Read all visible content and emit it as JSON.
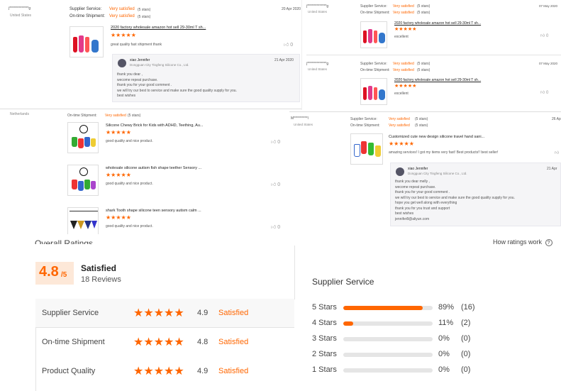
{
  "reviews": {
    "r1": {
      "name": "j**************g",
      "country": "United States",
      "service_label": "Supplier Service:",
      "service_value": "Very satisfied",
      "service_stars": "(5 stars)",
      "ship_label": "On-time Shipment:",
      "ship_value": "Very satisfied",
      "ship_stars": "(5 stars)",
      "date": "20 Apr 2020",
      "product": "2020 factory wholesale amazon hot sell 29-30ml T sh...",
      "rating": "★★★★★",
      "comment": "great quality fast shipment thank",
      "likes": "0",
      "reply": {
        "author": "xiao Jennifer",
        "company": "Dongguan City Tingfeng Silicone Co., Ltd.",
        "date": "21 Apr 2020",
        "lines": [
          "thank you dear ,",
          "wecome repeat purchase.",
          "thank you for your good comment .",
          "we will try our best to service and make sure the good quality supply for you.",
          "best wishes"
        ]
      }
    },
    "r2": {
      "name": "j**************g",
      "country": "United States",
      "service_label": "Supplier Service:",
      "service_value": "Very satisfied",
      "service_stars": "(5 stars)",
      "ship_label": "On-time Shipment:",
      "ship_value": "Very satisfied",
      "ship_stars": "(5 stars)",
      "date": "07 May 2020",
      "product": "2020 factory wholesale amazon hot sell 29-30ml T sh...",
      "rating": "★★★★★",
      "comment": "excellent",
      "likes": "0"
    },
    "r3": {
      "name": "j**************g",
      "country": "United States",
      "service_label": "Supplier Service:",
      "service_value": "Very satisfied",
      "service_stars": "(5 stars)",
      "ship_label": "On-time Shipment:",
      "ship_value": "Very satisfied",
      "ship_stars": "(5 stars)",
      "date": "07 May 2020",
      "product": "2020 factory wholesale amazon hot sell 29-30ml T sh...",
      "rating": "★★★★★",
      "comment": "excellent",
      "likes": "0"
    },
    "r4": {
      "country": "Netherlands",
      "ship_label": "On-time Shipment:",
      "ship_value": "Very satisfied",
      "ship_stars": "(5 stars)",
      "items": [
        {
          "product": "Silicone Chewy Brick for Kids with ADHD, Teething, Au...",
          "rating": "★★★★★",
          "comment": "good quality and nice product.",
          "likes": "0"
        },
        {
          "product": "wholesale silicone autism fish shape teether Sensory ...",
          "rating": "★★★★★",
          "comment": "good quality and nice product.",
          "likes": "0"
        },
        {
          "product": "shark Tooth shape silicone teen sensory autism calm ...",
          "rating": "★★★★★",
          "comment": "good quality and nice product.",
          "likes": "0"
        }
      ]
    },
    "r5": {
      "name": "M**********l",
      "country": "United States",
      "service_label": "Supplier Service:",
      "service_value": "Very satisfied",
      "service_stars": "(5 stars)",
      "ship_label": "On-time Shipment:",
      "ship_value": "Very satisfied",
      "ship_stars": "(5 stars)",
      "date": "26 Ap",
      "product": "Customized cute new design silicone travel hand sani...",
      "rating": "★★★★★",
      "comment": "amazing services! I got my items very fast! Best products!! best seller!",
      "likes": "0",
      "reply": {
        "author": "xiao Jennifer",
        "company": "Dongguan City Tingfeng Silicone Co., Ltd.",
        "date": "21 Apr",
        "lines": [
          "thank you dear melly ,",
          "wecome repeat purchase.",
          "thank you for your good comment .",
          "we will try our best to service and make sure the good quality supply for you.",
          "hope you get well along with everything",
          "thank you for you trust and support",
          "best wishes",
          "jennifer8@aliyun.com"
        ]
      }
    }
  },
  "overall": {
    "title": "Overall Ratings",
    "score": "4.8",
    "score_denom": "/5",
    "label": "Satisfied",
    "reviews": "18 Reviews",
    "how_link": "How ratings work",
    "help_icon": "?"
  },
  "categories": [
    {
      "label": "Supplier Service",
      "stars": "★★★★★",
      "score": "4.9",
      "word": "Satisfied"
    },
    {
      "label": "On-time Shipment",
      "stars": "★★★★★",
      "score": "4.8",
      "word": "Satisfied"
    },
    {
      "label": "Product Quality",
      "stars": "★★★★★",
      "score": "4.9",
      "word": "Satisfied"
    }
  ],
  "distribution": {
    "title": "Supplier Service",
    "rows": [
      {
        "label": "5 Stars",
        "fraction": 0.89,
        "pct": "89%",
        "count": "(16)"
      },
      {
        "label": "4 Stars",
        "fraction": 0.11,
        "pct": "11%",
        "count": "(2)"
      },
      {
        "label": "3 Stars",
        "fraction": 0,
        "pct": "0%",
        "count": "(0)"
      },
      {
        "label": "2 Stars",
        "fraction": 0,
        "pct": "0%",
        "count": "(0)"
      },
      {
        "label": "1 Stars",
        "fraction": 0,
        "pct": "0%",
        "count": "(0)"
      }
    ]
  },
  "colors": {
    "accent": "#ff6600",
    "bar_bg": "#e5e5e5"
  }
}
